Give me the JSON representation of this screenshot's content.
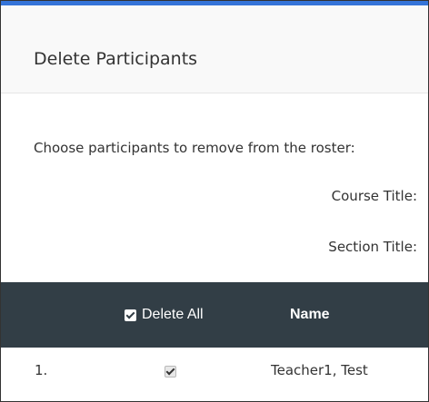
{
  "modal": {
    "title": "Delete Participants",
    "instructions": "Choose participants to remove from the roster:",
    "course_title_label": "Course Title:",
    "section_title_label": "Section Title:"
  },
  "table": {
    "columns": {
      "delete_all": "Delete All",
      "name": "Name"
    },
    "delete_all_checked": true,
    "rows": [
      {
        "index": "1.",
        "checked": true,
        "name": "Teacher1, Test"
      }
    ]
  },
  "colors": {
    "accent": "#3574d8",
    "table_header_bg": "#323e46"
  },
  "icons": [
    "checkbox-checked-icon"
  ]
}
